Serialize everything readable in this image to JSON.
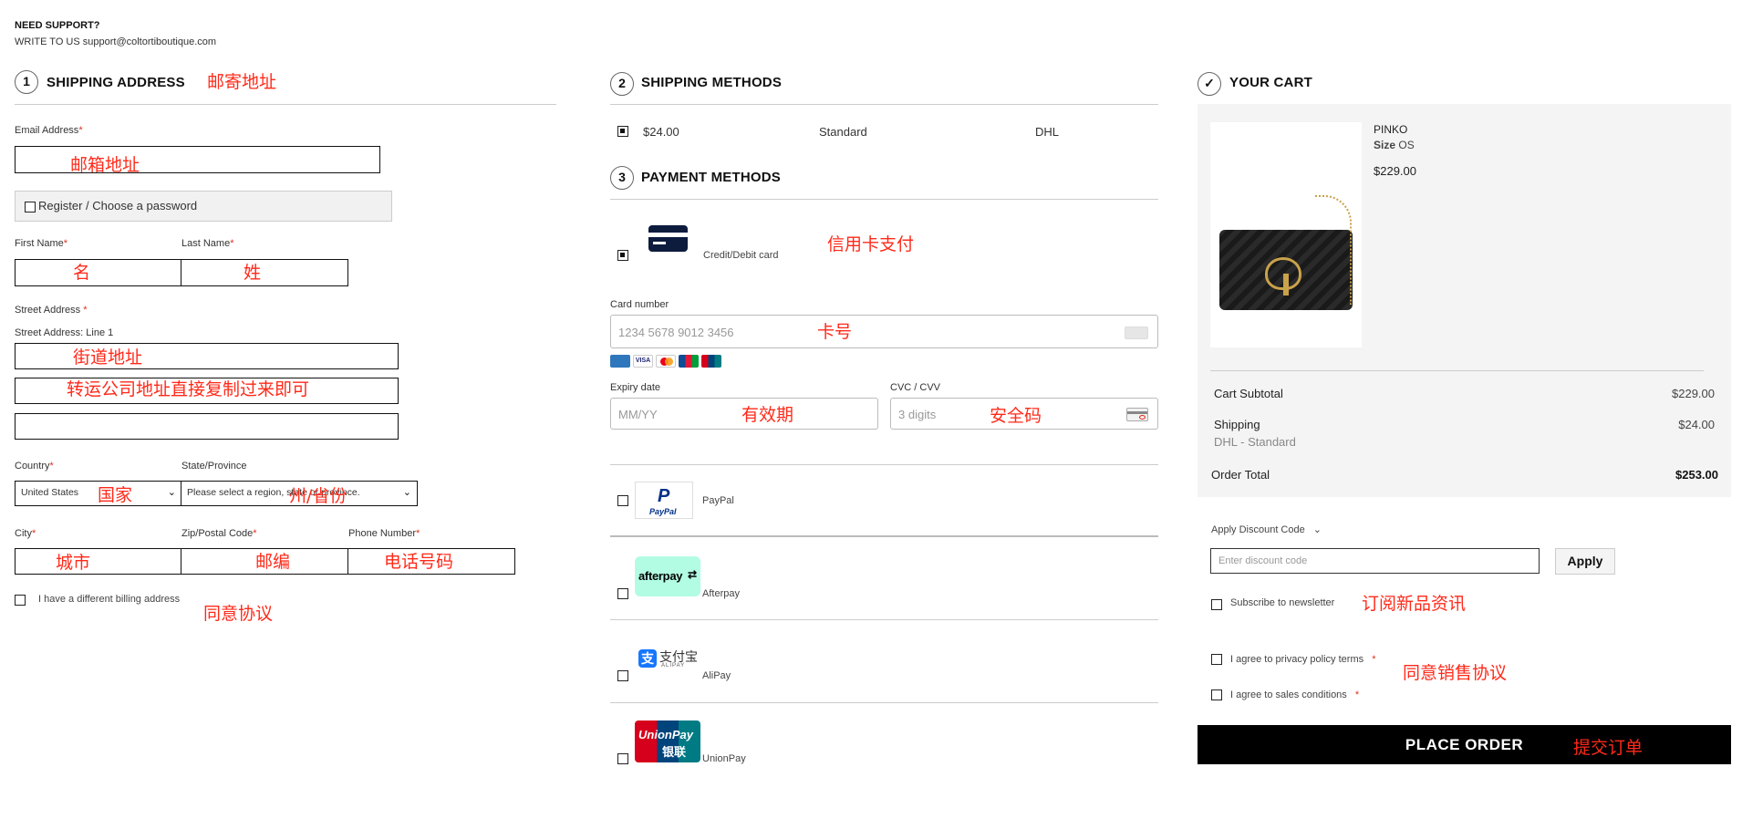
{
  "support": {
    "title": "NEED SUPPORT?",
    "line": "WRITE TO US support@coltortiboutique.com"
  },
  "shipping_address": {
    "step": "1",
    "title": "SHIPPING ADDRESS",
    "note": "邮寄地址",
    "email_label": "Email Address",
    "email_note": "邮箱地址",
    "register_label": "Register / Choose a password",
    "first_name_label": "First Name",
    "first_name_note": "名",
    "last_name_label": "Last Name",
    "last_name_note": "姓",
    "street_label": "Street Address",
    "street_line1_label": "Street Address: Line 1",
    "street_note": "街道地址",
    "street_note2": "转运公司地址直接复制过来即可",
    "country_label": "Country",
    "country_value": "United States",
    "country_note": "国家",
    "state_label": "State/Province",
    "state_value": "Please select a region, state or province.",
    "state_note": "州/省份",
    "city_label": "City",
    "city_note": "城市",
    "zip_label": "Zip/Postal Code",
    "zip_note": "邮编",
    "phone_label": "Phone Number",
    "phone_note": "电话号码",
    "billing_label": "I have a different billing address",
    "billing_note": "同意协议",
    "required_mark": "*"
  },
  "shipping_methods": {
    "step": "2",
    "title": "SHIPPING METHODS",
    "price": "$24.00",
    "method": "Standard",
    "carrier": "DHL"
  },
  "payment_methods": {
    "step": "3",
    "title": "PAYMENT METHODS",
    "card_label": "Credit/Debit card",
    "card_note": "信用卡支付",
    "card_number_label": "Card number",
    "card_number_placeholder": "1234 5678 9012 3456",
    "card_number_note": "卡号",
    "expiry_label": "Expiry date",
    "expiry_placeholder": "MM/YY",
    "expiry_note": "有效期",
    "cvc_label": "CVC / CVV",
    "cvc_placeholder": "3 digits",
    "cvc_note": "安全码",
    "paypal_label": "PayPal",
    "paypal_logo": "PayPal",
    "afterpay_label": "Afterpay",
    "afterpay_logo": "afterpay",
    "alipay_label": "AliPay",
    "alipay_logo_cn": "支付宝",
    "alipay_logo_en": "ALIPAY",
    "unionpay_label": "UnionPay",
    "unionpay_logo_en": "UnionPay",
    "unionpay_logo_cn": "银联"
  },
  "cart": {
    "title": "YOUR CART",
    "check_icon": "✓",
    "item": {
      "brand": "PINKO",
      "size_label": "Size",
      "size_value": "OS",
      "price": "$229.00"
    },
    "subtotal_label": "Cart Subtotal",
    "subtotal_value": "$229.00",
    "shipping_label": "Shipping",
    "shipping_value": "$24.00",
    "shipping_detail": "DHL - Standard",
    "total_label": "Order Total",
    "total_value": "$253.00",
    "discount_label": "Apply Discount Code",
    "discount_placeholder": "Enter discount code",
    "apply_label": "Apply",
    "newsletter_label": "Subscribe to newsletter",
    "newsletter_note": "订阅新品资讯",
    "privacy_label": "I agree to privacy policy terms",
    "sales_label": "I agree to sales conditions",
    "agree_note": "同意销售协议",
    "place_order_label": "PLACE ORDER",
    "place_order_note": "提交订单",
    "required_mark": "*"
  },
  "colors": {
    "annotation": "#ff2a1a",
    "accent": "#000000",
    "cart_bg": "#f4f4f4",
    "afterpay": "#b2fce4",
    "paypal_blue": "#003087"
  }
}
